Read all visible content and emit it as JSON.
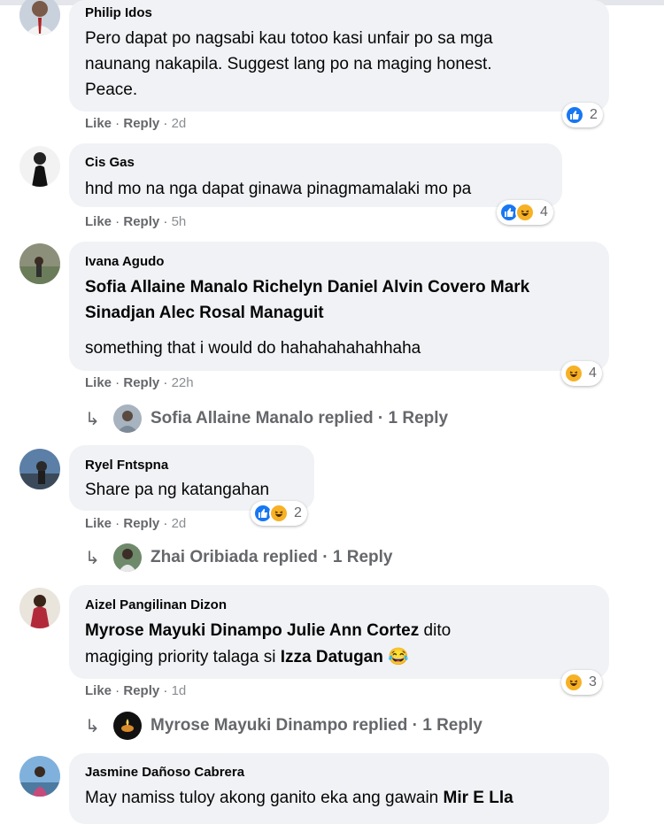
{
  "meta_labels": {
    "like": "Like",
    "reply": "Reply",
    "sep": " · "
  },
  "comments": [
    {
      "author": "Philip Idos",
      "lines": [
        "Pero dapat po nagsabi kau totoo kasi unfair po sa mga",
        "naunang nakapila. Suggest lang po na maging honest.",
        "Peace."
      ],
      "time": "2d",
      "reaction_icons": [
        "like-icon"
      ],
      "reaction_count": "2"
    },
    {
      "author": "Cis Gas",
      "lines": [
        "hnd mo na nga dapat ginawa pinagmamalaki mo pa"
      ],
      "time": "5h",
      "reaction_icons": [
        "like-icon",
        "haha-icon"
      ],
      "reaction_count": "4"
    },
    {
      "author": "Ivana Agudo",
      "tag_lines": [
        "Sofia Allaine Manalo Richelyn Daniel Alvin Covero Mark",
        "Sinadjan Alec Rosal Managuit"
      ],
      "lines": [
        "something that i would do hahahahahahhaha"
      ],
      "time": "22h",
      "reaction_icons": [
        "haha-icon"
      ],
      "reaction_count": "4",
      "replies_label": "Sofia Allaine Manalo replied · 1 Reply"
    },
    {
      "author": "Ryel Fntspna",
      "lines": [
        "Share pa ng katangahan"
      ],
      "time": "2d",
      "reaction_icons": [
        "like-icon",
        "haha-icon"
      ],
      "reaction_count": "2",
      "replies_label": "Zhai Oribiada replied · 1 Reply"
    },
    {
      "author": "Aizel Pangilinan Dizon",
      "line1_tag": "Myrose Mayuki Dinampo Julie Ann Cortez",
      "line1_text": " dito",
      "line2_text": "magiging priority talaga si ",
      "line2_tag": "Izza Datugan",
      "line2_emoji": " 😂",
      "time": "1d",
      "reaction_icons": [
        "haha-icon"
      ],
      "reaction_count": "3",
      "replies_label": "Myrose Mayuki Dinampo replied · 1 Reply"
    },
    {
      "author": "Jasmine Dañoso Cabrera",
      "line_text": "May namiss tuloy akong ganito eka ang gawain ",
      "line_tag": "Mir E Lla"
    }
  ]
}
